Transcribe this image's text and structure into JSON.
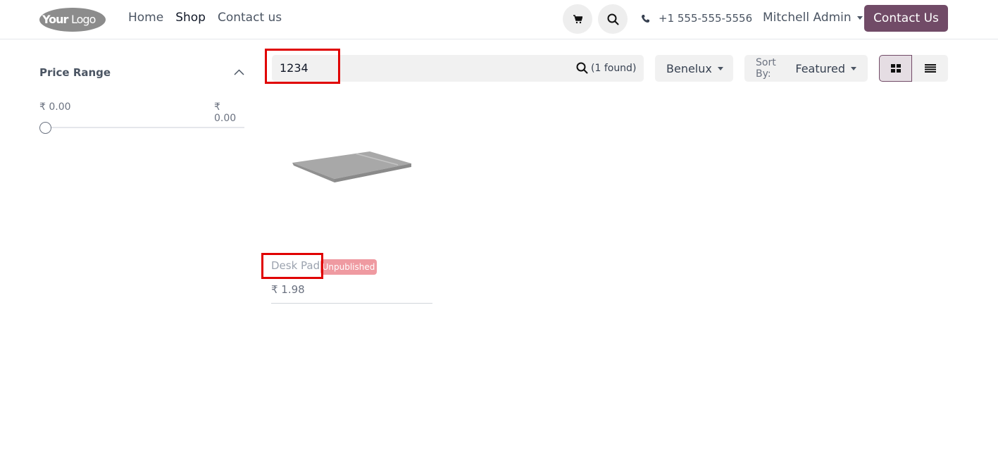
{
  "header": {
    "logo_text": "YourLogo",
    "nav": [
      {
        "label": "Home"
      },
      {
        "label": "Shop",
        "active": true
      },
      {
        "label": "Contact us"
      }
    ],
    "phone": "+1 555-555-5556",
    "user": "Mitchell Admin",
    "contact_button": "Contact Us",
    "icons": {
      "cart": "cart-icon",
      "search": "search-icon",
      "phone": "phone-icon"
    }
  },
  "sidebar": {
    "price_range_title": "Price Range",
    "min_price": "₹ 0.00",
    "max_price": "₹ 0.00",
    "slider_value": 0
  },
  "toolbar": {
    "search_value": "1234",
    "found_text": "(1 found)",
    "pricelist": "Benelux",
    "sort_prefix": "Sort By:",
    "sort_value": "Featured",
    "view_mode": "grid"
  },
  "products": [
    {
      "name": "Desk Pad",
      "badge": "Unpublished",
      "price": "₹ 1.98"
    }
  ],
  "colors": {
    "brand": "#714b67",
    "badge": "#ef9aa1",
    "highlight": "#e00000"
  }
}
